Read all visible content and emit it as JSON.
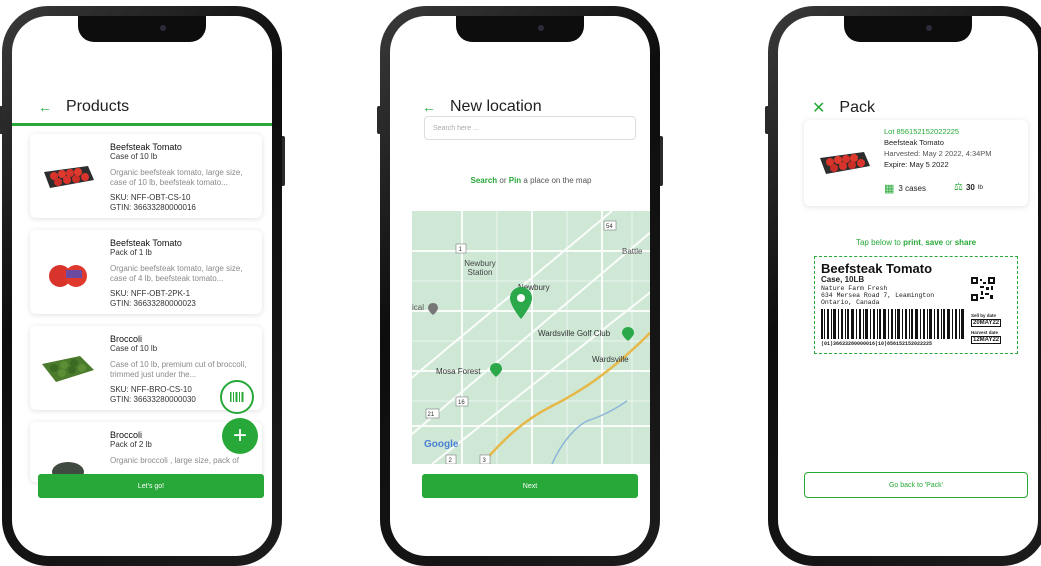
{
  "screen1": {
    "title": "Products",
    "products": [
      {
        "name": "Beefsteak Tomato",
        "pack": "Case of 10 lb",
        "desc": "Organic beefsteak tomato, large size, case of 10 lb, beefsteak tomato...",
        "sku": "SKU: NFF-OBT-CS-10",
        "gtin": "GTIN: 36633280000016"
      },
      {
        "name": "Beefsteak Tomato",
        "pack": "Pack of 1 lb",
        "desc": "Organic beefsteak tomato, large size, case of 4 lb, beefsteak tomato...",
        "sku": "SKU: NFF-OBT-2PK-1",
        "gtin": "GTIN: 36633280000023"
      },
      {
        "name": "Broccoli",
        "pack": "Case of 10 lb",
        "desc": "Case of 10 lb, premium cut of broccoli, trimmed just under the...",
        "sku": "SKU: NFF-BRO-CS-10",
        "gtin": "GTIN: 36633280000030"
      },
      {
        "name": "Broccoli",
        "pack": "Pack of 2 lb",
        "desc": "Organic broccoli , large size, pack of",
        "sku": "",
        "gtin": ""
      }
    ],
    "button": "Let's go!"
  },
  "screen2": {
    "title": "New location",
    "search_placeholder": "Search here ...",
    "hint_search": "Search",
    "hint_or": " or ",
    "hint_pin": "Pin",
    "hint_rest": " a place on the map",
    "map_labels": {
      "newbury_station": "Newbury Station",
      "newbury": "Newbury",
      "battle": "Battle",
      "golf": "Wardsville Golf Club",
      "wardsville": "Wardsville",
      "mosa": "Mosa Forest",
      "ical": "ical",
      "google": "Google",
      "route_54": "54",
      "route_1": "1",
      "route_16": "16",
      "route_21": "21",
      "route_2": "2",
      "route_3": "3"
    },
    "button": "Next"
  },
  "screen3": {
    "title": "Pack",
    "lot": "Lot 856152152022225",
    "product": "Beefsteak Tomato",
    "harvested": "Harvested: May 2 2022, 4:34PM",
    "expire": "Expire: May 5 2022",
    "cases": "3 cases",
    "weight": "30",
    "weight_unit": "lb",
    "tap_pre": "Tap below to ",
    "tap_print": "print",
    "tap_c1": ", ",
    "tap_save": "save",
    "tap_or": " or ",
    "tap_share": "share",
    "label": {
      "title": "Beefsteak Tomato",
      "case": "Case, 10LB",
      "farm": "Nature Farm Fresh",
      "addr1": "634 Mersea Road 7, Leamington",
      "addr2": "Ontario, Canada",
      "sell_by_label": "Sell by date",
      "sell_by": "20MAY22",
      "harvest_label": "Harvest date",
      "harvest": "12MAY22",
      "barcode_text": "(01)36633280000016(10)856152152022225"
    },
    "button": "Go back to 'Pack'"
  },
  "colors": {
    "accent": "#27a838",
    "map": "#cfe8d6"
  }
}
